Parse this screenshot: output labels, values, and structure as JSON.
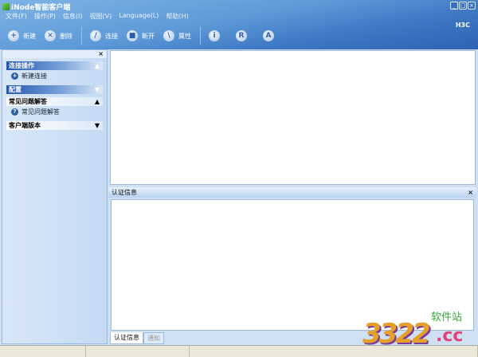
{
  "window": {
    "title": "iNode智能客户端",
    "controls": [
      "_",
      "□",
      "×"
    ]
  },
  "menu": [
    "文件(F)",
    "操作(P)",
    "信息(I)",
    "视图(V)",
    "Language(L)",
    "帮助(H)"
  ],
  "toolbar": {
    "new": "新建",
    "delete": "删除",
    "connect": "连接",
    "disconnect": "断开",
    "properties": "属性",
    "info": "i",
    "r": "R",
    "a": "A",
    "brand": "H3C"
  },
  "sidebar": {
    "close": "×",
    "sections": [
      {
        "title": "连接操作",
        "arrow": "▲",
        "items": [
          "新建连接"
        ]
      },
      {
        "title": "配置",
        "arrow": "▼",
        "items": []
      },
      {
        "title": "常见问题解答",
        "arrow": "▲",
        "items": [
          "常见问题解答"
        ]
      },
      {
        "title": "客户端版本",
        "arrow": "▼",
        "items": []
      }
    ]
  },
  "auth": {
    "title": "认证信息",
    "close": "×",
    "tabs": [
      "认证信息",
      "通知"
    ]
  },
  "watermark": {
    "number": "3322",
    "domain": ".cc",
    "label": "软件站"
  }
}
